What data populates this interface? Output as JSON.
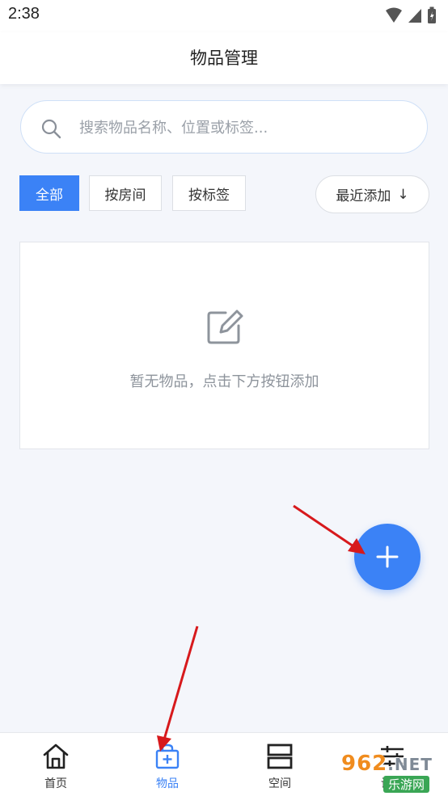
{
  "status_bar": {
    "time": "2:38"
  },
  "header": {
    "title": "物品管理"
  },
  "search": {
    "placeholder": "搜索物品名称、位置或标签..."
  },
  "filters": [
    {
      "label": "全部",
      "active": true
    },
    {
      "label": "按房间",
      "active": false
    },
    {
      "label": "按标签",
      "active": false
    }
  ],
  "sort": {
    "label": "最近添加",
    "arrow": "↓"
  },
  "empty_state": {
    "text": "暂无物品，点击下方按钮添加",
    "icon": "edit-icon"
  },
  "fab": {
    "icon": "plus-icon"
  },
  "bottom_nav": [
    {
      "label": "首页",
      "icon": "home-icon",
      "active": false
    },
    {
      "label": "物品",
      "icon": "box-icon",
      "active": true
    },
    {
      "label": "空间",
      "icon": "space-icon",
      "active": false
    },
    {
      "label": "设置",
      "icon": "settings-icon",
      "active": false
    }
  ],
  "watermark": {
    "brand": "962",
    "suffix": ".NET",
    "tagline": "乐游网"
  },
  "colors": {
    "accent": "#3b82f6",
    "background": "#f4f6fb",
    "arrow": "#d7191c"
  }
}
